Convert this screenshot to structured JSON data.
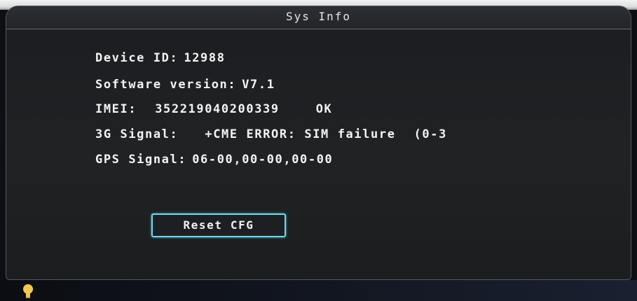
{
  "window": {
    "title": "Sys Info"
  },
  "info": {
    "device_id_label": "Device ID:",
    "device_id_value": "12988",
    "software_label": "Software version:",
    "software_value": "V7.1",
    "imei_label": "IMEI:",
    "imei_value": "352219040200339",
    "imei_status": "OK",
    "signal_3g_label": "3G Signal:",
    "signal_3g_value": "+CME ERROR: SIM failure",
    "signal_3g_extra": "(0-3",
    "gps_label": "GPS Signal:",
    "gps_value": "06-00,00-00,00-00"
  },
  "actions": {
    "reset_label": "Reset CFG"
  },
  "colors": {
    "button_border": "#6fd6ea",
    "text": "#f4f4f4",
    "indicator": "#f2c94c"
  },
  "icons": {
    "indicator": "lightbulb-icon"
  }
}
